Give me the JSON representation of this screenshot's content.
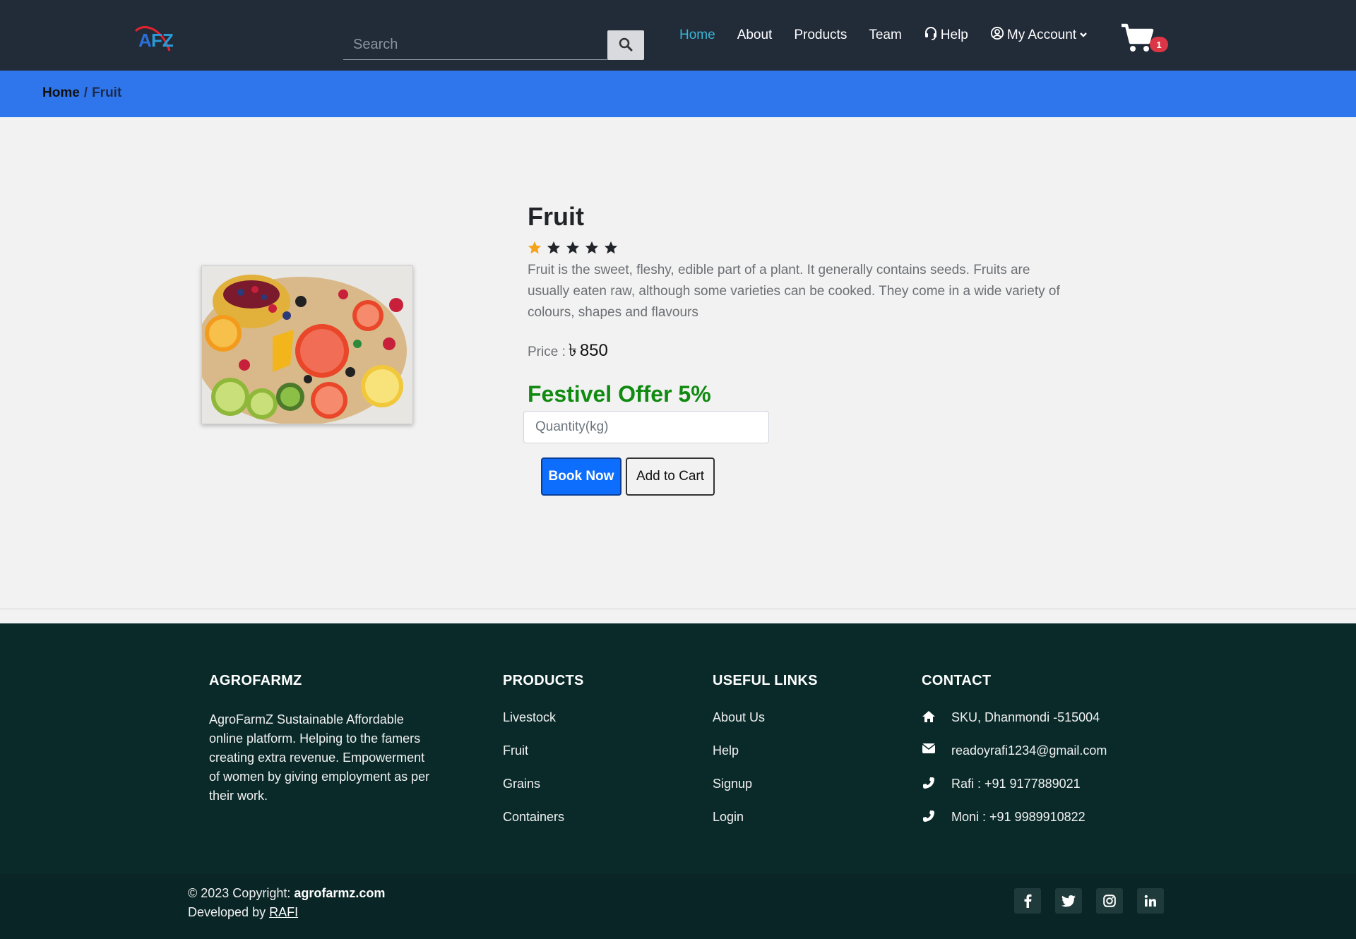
{
  "colors": {
    "navbar_bg": "#222b38",
    "nav_active": "#38b6d8",
    "breadcrumb_bg": "#2f76ec",
    "page_bg": "#f2f2f2",
    "offer_green": "#108a10",
    "primary_button": "#0d6efd",
    "footer_bg": "#0a2a2a",
    "badge_red": "#dc3545",
    "star_active": "#f6a319"
  },
  "header": {
    "logo_text": "AFZ",
    "search": {
      "placeholder": "Search",
      "value": "",
      "icon": "search-icon"
    },
    "nav": [
      {
        "label": "Home",
        "active": true
      },
      {
        "label": "About",
        "active": false
      },
      {
        "label": "Products",
        "active": false
      },
      {
        "label": "Team",
        "active": false
      },
      {
        "label": "Help",
        "icon": "headset-icon",
        "active": false
      },
      {
        "label": "My Account",
        "icon": "user-circle-icon",
        "dropdown": true,
        "active": false
      }
    ],
    "cart": {
      "icon": "cart-icon",
      "count": "1"
    }
  },
  "breadcrumb": {
    "home": "Home",
    "separator": "/",
    "current": "Fruit"
  },
  "product": {
    "title": "Fruit",
    "rating": {
      "value": 1,
      "max": 5
    },
    "description": "Fruit is the sweet, fleshy, edible part of a plant. It generally contains seeds. Fruits are usually eaten raw, although some varieties can be cooked. They come in a wide variety of colours, shapes and flavours",
    "price_label": "Price :",
    "currency": "৳",
    "price": "850",
    "offer": "Festivel Offer 5%",
    "quantity": {
      "placeholder": "Quantity(kg)",
      "value": ""
    },
    "book_label": "Book Now",
    "cart_label": "Add to Cart"
  },
  "footer": {
    "brand": {
      "heading": "AGROFARMZ",
      "text": "AgroFarmZ Sustainable Affordable online platform. Helping to the famers creating extra revenue. Empowerment of women by giving employment as per their work."
    },
    "products": {
      "heading": "PRODUCTS",
      "items": [
        "Livestock",
        "Fruit",
        "Grains",
        "Containers"
      ]
    },
    "links": {
      "heading": "USEFUL LINKS",
      "items": [
        "About Us",
        "Help",
        "Signup",
        "Login"
      ]
    },
    "contact": {
      "heading": "CONTACT",
      "items": [
        {
          "icon": "home-icon",
          "text": "SKU, Dhanmondi -515004"
        },
        {
          "icon": "envelope-icon",
          "text": "readoyrafi1234@gmail.com"
        },
        {
          "icon": "phone-icon",
          "text": "Rafi : +91 9177889021"
        },
        {
          "icon": "phone-icon",
          "text": "Moni : +91 9989910822"
        }
      ]
    },
    "copyright_prefix": "© 2023 Copyright:",
    "copyright_site": "agrofarmz.com",
    "developed_prefix": "Developed by",
    "developer": "RAFI",
    "socials": [
      "facebook-icon",
      "twitter-icon",
      "instagram-icon",
      "linkedin-icon"
    ]
  }
}
